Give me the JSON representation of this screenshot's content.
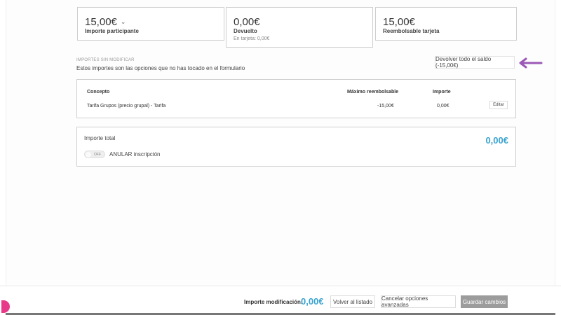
{
  "summary": {
    "participant": {
      "amount": "15,00€",
      "label": "Importe participante"
    },
    "returned": {
      "amount": "0,00€",
      "label": "Devuelto",
      "sub": "En tarjeta: 0,00€"
    },
    "refundable": {
      "amount": "15,00€",
      "label": "Reembolsable tarjeta"
    }
  },
  "section": {
    "caption": "IMPORTES SIN MODIFICAR",
    "description": "Estos importes son las opciones que no has tocado en el formulario",
    "refund_all_label": "Devolver todo el saldo (-15,00€)"
  },
  "table": {
    "headers": {
      "concept": "Concepto",
      "max_refundable": "Máximo reembolsable",
      "amount": "Importe"
    },
    "rows": [
      {
        "concept": "Tarifa Grupos (precio grupal) - Tarifa",
        "max_refundable": "-15,00€",
        "amount": "0,00€",
        "edit_label": "Editar"
      }
    ]
  },
  "total": {
    "label": "Importe total",
    "amount": "0,00€",
    "toggle_state": "OFF",
    "toggle_label": "ANULAR inscripción"
  },
  "footer": {
    "mod_label": "Importe modificación:",
    "mod_amount": "0,00€",
    "back_label": "Volver al listado",
    "cancel_label": "Cancelar opciones avanzadas",
    "save_label": "Guardar cambios"
  },
  "colors": {
    "accent_blue": "#3aa3cf",
    "arrow_purple": "#9b59b6",
    "brand_pink": "#e8388a"
  }
}
